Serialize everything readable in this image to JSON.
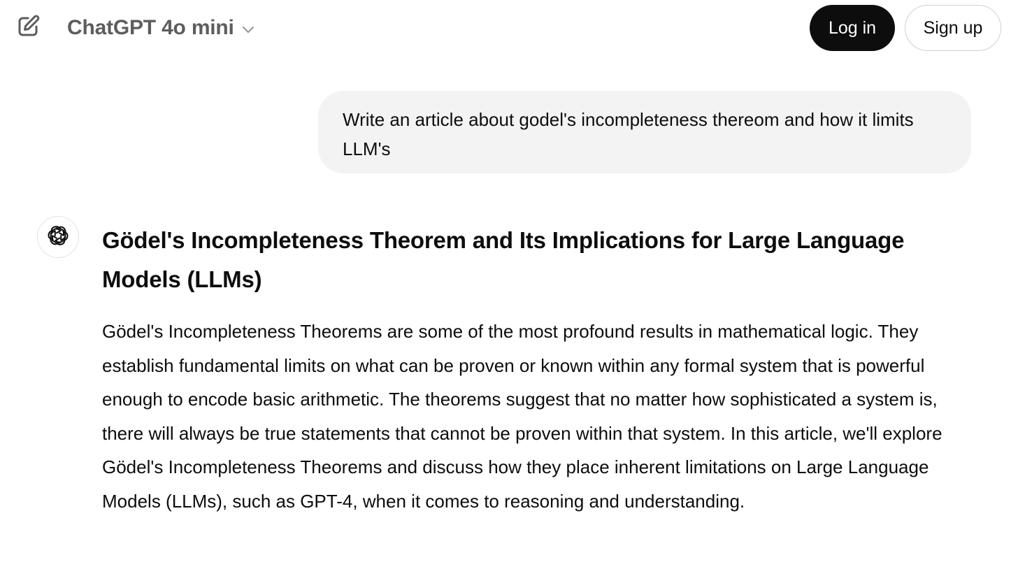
{
  "header": {
    "new_chat_icon": "new-chat-icon",
    "model_name": "ChatGPT 4o mini",
    "model_chevron_icon": "chevron-down-icon",
    "login_label": "Log in",
    "signup_label": "Sign up"
  },
  "conversation": {
    "user_message": "Write an article about godel's incompleteness thereom and how it limits LLM's",
    "assistant_avatar_icon": "openai-logo-icon",
    "assistant_title": "Gödel's Incompleteness Theorem and Its Implications for Large Language Models (LLMs)",
    "assistant_paragraph": "Gödel's Incompleteness Theorems are some of the most profound results in mathematical logic. They establish fundamental limits on what can be proven or known within any formal system that is powerful enough to encode basic arithmetic. The theorems suggest that no matter how sophisticated a system is, there will always be true statements that cannot be proven within that system. In this article, we'll explore Gödel's Incompleteness Theorems and discuss how they place inherent limitations on Large Language Models (LLMs), such as GPT-4, when it comes to reasoning and understanding."
  },
  "colors": {
    "login_bg": "#0d0d0d",
    "bubble_bg": "#f3f3f3",
    "muted_text": "#5d5d5d"
  }
}
